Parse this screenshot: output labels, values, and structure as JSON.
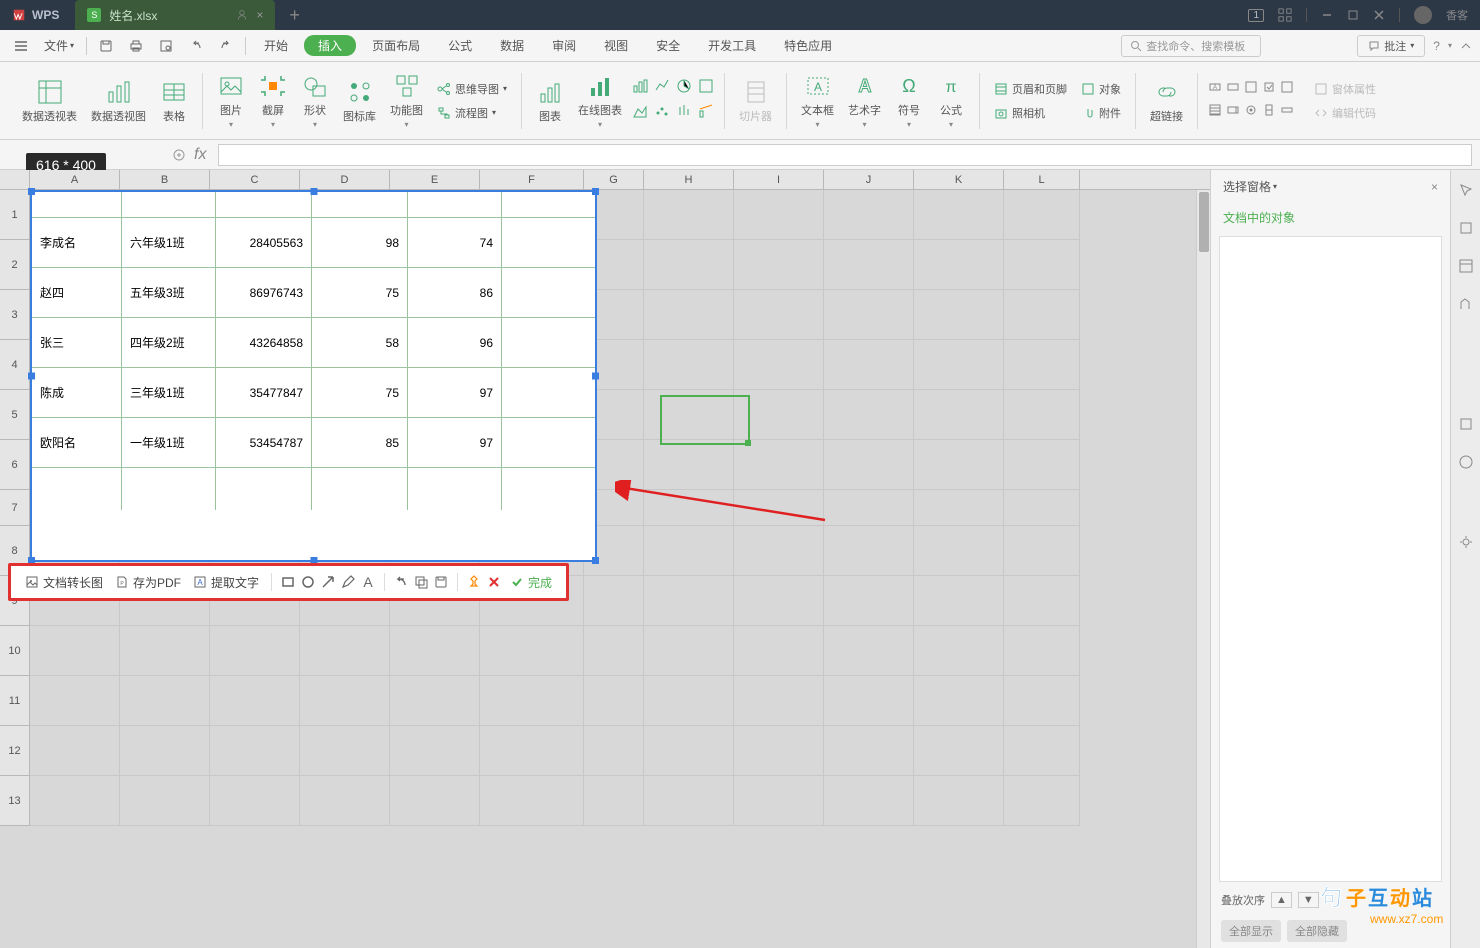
{
  "titlebar": {
    "app_name": "WPS",
    "file_name": "姓名.xlsx",
    "badge": "1",
    "user_label": "香客"
  },
  "menu": {
    "file": "文件",
    "tabs": [
      "开始",
      "插入",
      "页面布局",
      "公式",
      "数据",
      "审阅",
      "视图",
      "安全",
      "开发工具",
      "特色应用"
    ],
    "active_idx": 1,
    "search_placeholder": "查找命令、搜索模板",
    "comment": "批注"
  },
  "ribbon": {
    "pivot_table": "数据透视表",
    "pivot_chart": "数据透视图",
    "table": "表格",
    "picture": "图片",
    "screenshot": "截屏",
    "shapes": "形状",
    "iconlib": "图标库",
    "smartart": "功能图",
    "mindmap": "思维导图",
    "flowchart": "流程图",
    "chart": "图表",
    "online_chart": "在线图表",
    "slicer": "切片器",
    "textbox": "文本框",
    "wordart": "艺术字",
    "symbol": "符号",
    "equation": "公式",
    "header_footer": "页眉和页脚",
    "object": "对象",
    "camera": "照相机",
    "attachment": "附件",
    "hyperlink": "超链接",
    "form_props": "窗体属性",
    "view_code": "编辑代码"
  },
  "name_box": {
    "dimensions": "616 * 400"
  },
  "columns": [
    "A",
    "B",
    "C",
    "D",
    "E",
    "F",
    "G",
    "H",
    "I",
    "J",
    "K",
    "L"
  ],
  "data_rows": [
    {
      "name": "李成名",
      "class": "六年级1班",
      "id": "28405563",
      "s1": "98",
      "s2": "74"
    },
    {
      "name": "赵四",
      "class": "五年级3班",
      "id": "86976743",
      "s1": "75",
      "s2": "86"
    },
    {
      "name": "张三",
      "class": "四年级2班",
      "id": "43264858",
      "s1": "58",
      "s2": "96"
    },
    {
      "name": "陈成",
      "class": "三年级1班",
      "id": "35477847",
      "s1": "75",
      "s2": "97"
    },
    {
      "name": "欧阳名",
      "class": "一年级1班",
      "id": "53454787",
      "s1": "85",
      "s2": "97"
    }
  ],
  "shot_toolbar": {
    "doc_to_img": "文档转长图",
    "save_pdf": "存为PDF",
    "extract_text": "提取文字",
    "done": "完成"
  },
  "right_panel": {
    "title": "选择窗格",
    "subtitle": "文档中的对象",
    "stack_order": "叠放次序",
    "show_all": "全部显示",
    "hide_all": "全部隐藏"
  },
  "watermark_url": "www.xz7.com"
}
